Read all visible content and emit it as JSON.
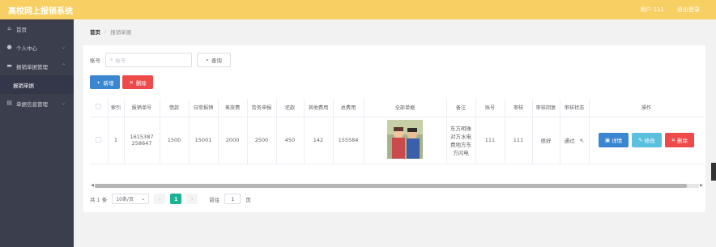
{
  "app": {
    "title": "高校网上报销系统"
  },
  "topbar": {
    "user": "用户 111",
    "logout": "退出登录"
  },
  "sidebar": {
    "items": [
      {
        "label": "首页",
        "icon": "home-icon"
      },
      {
        "label": "个人中心",
        "icon": "user-icon"
      },
      {
        "label": "报销单据管理",
        "icon": "briefcase-icon"
      },
      {
        "label": "报销单据"
      },
      {
        "label": "单据信息管理",
        "icon": "document-icon"
      }
    ]
  },
  "breadcrumb": {
    "home": "首页",
    "separator": "/",
    "current": "报销单据"
  },
  "search": {
    "label": "账号",
    "placeholder": "账号",
    "button": "查询"
  },
  "actions": {
    "add": "新增",
    "delete": "删除"
  },
  "table": {
    "headers": [
      "索引",
      "报销单号",
      "借款",
      "日常报销",
      "差旅费",
      "劳务申报",
      "还款",
      "其他费用",
      "总费用",
      "全部单据",
      "备注",
      "账号",
      "审核",
      "审核回复",
      "审核状态",
      "操作"
    ],
    "rows": [
      {
        "index": "1",
        "order_no_line1": "1615387",
        "order_no_line2": "258647",
        "loan": "1500",
        "daily": "15001",
        "travel": "2000",
        "labor": "2500",
        "repay": "450",
        "other": "142",
        "total": "155584",
        "remark_line1": "东方明珠",
        "remark_line2": "对方水电",
        "remark_line3": "费地方东",
        "remark_line4": "方闪电",
        "account": "111",
        "reviewer": "111",
        "reply": "很好",
        "status": "通过",
        "btn_detail": "详情",
        "btn_edit": "修改",
        "btn_delete": "删除"
      }
    ]
  },
  "pager": {
    "total": "共 1 条",
    "page_size": "10条/页",
    "current_page": "1",
    "goto_label": "前往",
    "goto_value": "1",
    "page_suffix": "页"
  },
  "colors": {
    "topbar": "#f7cf63",
    "sidebar": "#3b3e4d",
    "primary": "#3a86d1",
    "danger": "#ee4a4a",
    "info": "#5bc0de",
    "pager_active": "#1ab394"
  }
}
